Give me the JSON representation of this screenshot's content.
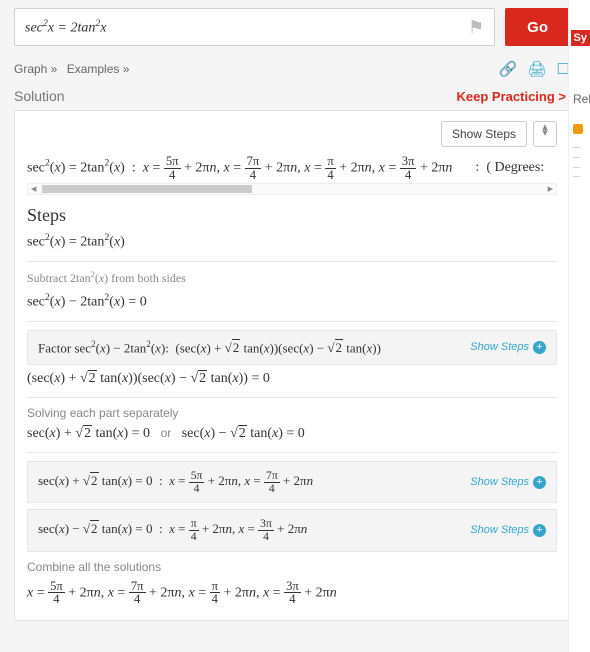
{
  "search": {
    "value": "sec²x = 2tan²x"
  },
  "go_label": "Go",
  "links": {
    "graph": "Graph »",
    "examples": "Examples »"
  },
  "section": {
    "title": "Solution",
    "keep": "Keep Practicing >"
  },
  "show_steps_btn": "Show Steps",
  "degrees_label": "( Degrees:",
  "steps_title": "Steps",
  "hints": {
    "subtract": "Subtract 2tan²(x) from both sides",
    "factor_prefix": "Factor sec²(x) − 2tan²(x):",
    "solving": "Solving each part separately",
    "combine": "Combine all the solutions"
  },
  "or_label": "or",
  "show_steps_link": "Show Steps",
  "right": {
    "sy": "Sy",
    "related": "Relate"
  }
}
